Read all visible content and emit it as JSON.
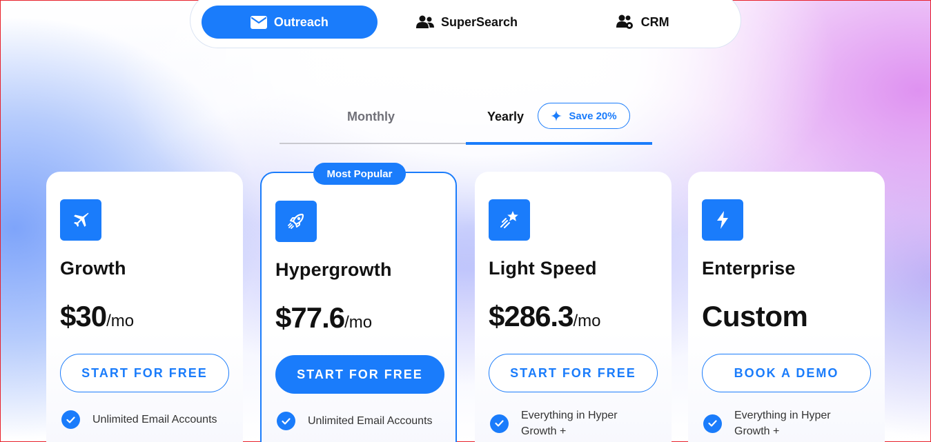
{
  "product_tabs": [
    {
      "label": "Outreach",
      "icon": "envelope-icon",
      "active": true
    },
    {
      "label": "SuperSearch",
      "icon": "users-icon",
      "active": false
    },
    {
      "label": "CRM",
      "icon": "users-gear-icon",
      "active": false
    }
  ],
  "billing": {
    "monthly_label": "Monthly",
    "yearly_label": "Yearly",
    "selected": "Yearly",
    "save_badge": "Save 20%"
  },
  "plans": [
    {
      "name": "Growth",
      "icon": "plane-icon",
      "price": "$30",
      "period": "/mo",
      "cta": "START FOR FREE",
      "features": [
        "Unlimited Email Accounts"
      ]
    },
    {
      "name": "Hypergrowth",
      "icon": "rocket-icon",
      "badge": "Most Popular",
      "price": "$77.6",
      "period": "/mo",
      "cta": "START FOR FREE",
      "features": [
        "Unlimited Email Accounts"
      ]
    },
    {
      "name": "Light Speed",
      "icon": "shooting-star-icon",
      "price": "$286.3",
      "period": "/mo",
      "cta": "START FOR FREE",
      "features": [
        "Everything in Hyper\nGrowth +"
      ]
    },
    {
      "name": "Enterprise",
      "icon": "lightning-icon",
      "price": "Custom",
      "cta": "BOOK A DEMO",
      "features": [
        "Everything in Hyper\nGrowth +"
      ]
    }
  ],
  "colors": {
    "accent": "#1a7cfb",
    "text": "#111111",
    "muted": "#707078"
  }
}
